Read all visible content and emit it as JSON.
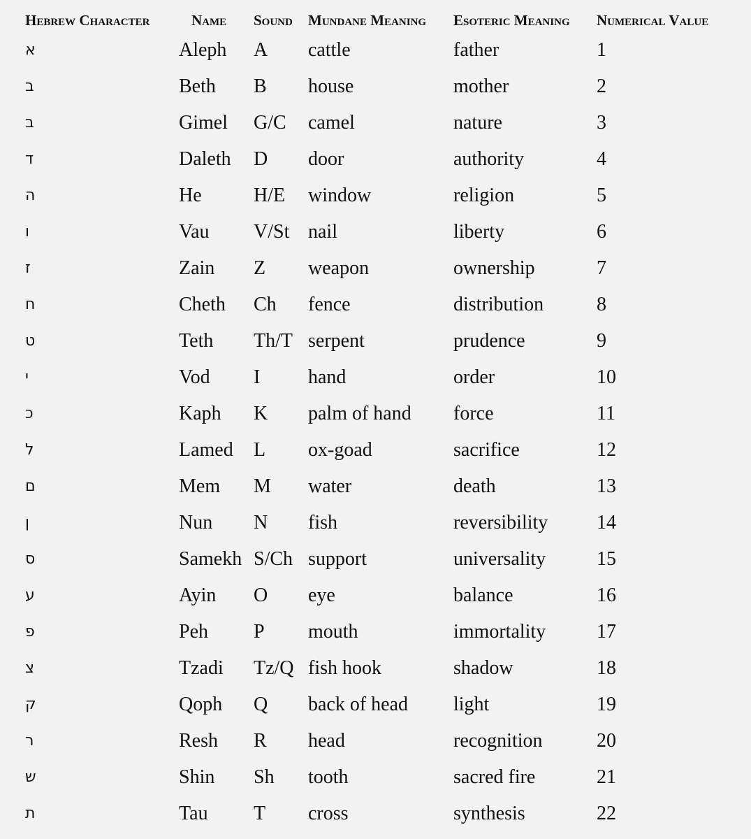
{
  "table": {
    "headers": {
      "hebrew": "Hebrew Character",
      "name": "Name",
      "sound": "Sound",
      "mundane": "Mundane Meaning",
      "esoteric": "Esoteric Meaning",
      "numerical": "Numerical Value"
    },
    "rows": [
      {
        "hebrew": "א",
        "name": "Aleph",
        "sound": "A",
        "mundane": "cattle",
        "esoteric": "father",
        "numerical": "1"
      },
      {
        "hebrew": "ב",
        "name": "Beth",
        "sound": "B",
        "mundane": "house",
        "esoteric": "mother",
        "numerical": "2"
      },
      {
        "hebrew": "ב",
        "name": "Gimel",
        "sound": "G/C",
        "mundane": "camel",
        "esoteric": "nature",
        "numerical": "3"
      },
      {
        "hebrew": "ד",
        "name": "Daleth",
        "sound": "D",
        "mundane": "door",
        "esoteric": "authority",
        "numerical": "4"
      },
      {
        "hebrew": "ה",
        "name": "He",
        "sound": "H/E",
        "mundane": "window",
        "esoteric": "religion",
        "numerical": "5"
      },
      {
        "hebrew": "ו",
        "name": "Vau",
        "sound": "V/St",
        "mundane": "nail",
        "esoteric": "liberty",
        "numerical": "6"
      },
      {
        "hebrew": "ז",
        "name": "Zain",
        "sound": "Z",
        "mundane": "weapon",
        "esoteric": "ownership",
        "numerical": "7"
      },
      {
        "hebrew": "ח",
        "name": "Cheth",
        "sound": "Ch",
        "mundane": "fence",
        "esoteric": "distribution",
        "numerical": "8"
      },
      {
        "hebrew": "ט",
        "name": "Teth",
        "sound": "Th/T",
        "mundane": "serpent",
        "esoteric": "prudence",
        "numerical": "9"
      },
      {
        "hebrew": "י",
        "name": "Vod",
        "sound": "I",
        "mundane": "hand",
        "esoteric": "order",
        "numerical": "10"
      },
      {
        "hebrew": "כ",
        "name": "Kaph",
        "sound": "K",
        "mundane": "palm of hand",
        "esoteric": "force",
        "numerical": "11"
      },
      {
        "hebrew": "ל",
        "name": "Lamed",
        "sound": "L",
        "mundane": "ox-goad",
        "esoteric": "sacrifice",
        "numerical": "12"
      },
      {
        "hebrew": "ם",
        "name": "Mem",
        "sound": "M",
        "mundane": "water",
        "esoteric": "death",
        "numerical": "13"
      },
      {
        "hebrew": "ן",
        "name": "Nun",
        "sound": "N",
        "mundane": "fish",
        "esoteric": "reversibility",
        "numerical": "14"
      },
      {
        "hebrew": "ס",
        "name": "Samekh",
        "sound": "S/Ch",
        "mundane": "support",
        "esoteric": "universality",
        "numerical": "15"
      },
      {
        "hebrew": "ע",
        "name": "Ayin",
        "sound": "O",
        "mundane": "eye",
        "esoteric": "balance",
        "numerical": "16"
      },
      {
        "hebrew": "פ",
        "name": "Peh",
        "sound": "P",
        "mundane": "mouth",
        "esoteric": "immortality",
        "numerical": "17"
      },
      {
        "hebrew": "צ",
        "name": "Tzadi",
        "sound": "Tz/Q",
        "mundane": "fish hook",
        "esoteric": "shadow",
        "numerical": "18"
      },
      {
        "hebrew": "ק",
        "name": "Qoph",
        "sound": "Q",
        "mundane": "back of head",
        "esoteric": "light",
        "numerical": "19"
      },
      {
        "hebrew": "ר",
        "name": "Resh",
        "sound": "R",
        "mundane": "head",
        "esoteric": "recognition",
        "numerical": "20"
      },
      {
        "hebrew": "ש",
        "name": "Shin",
        "sound": "Sh",
        "mundane": "tooth",
        "esoteric": "sacred fire",
        "numerical": "21"
      },
      {
        "hebrew": "ת",
        "name": "Tau",
        "sound": "T",
        "mundane": "cross",
        "esoteric": "synthesis",
        "numerical": "22"
      }
    ]
  }
}
